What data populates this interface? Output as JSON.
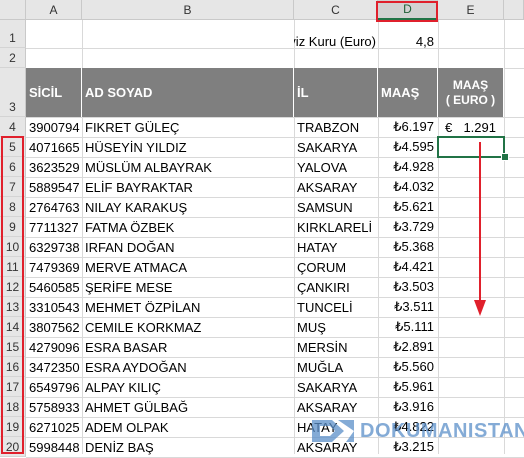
{
  "columns": [
    "A",
    "B",
    "C",
    "D",
    "E"
  ],
  "rate_label": "Döviz Kuru (Euro)",
  "rate_value": "4,8",
  "headers": {
    "sicil": "SİCİL",
    "ad_soyad": "AD SOYAD",
    "il": "İL",
    "maas": "MAAŞ",
    "maas_euro_1": "MAAŞ",
    "maas_euro_2": "( EURO )"
  },
  "euro_symbol": "€",
  "row4_euro": "1.291",
  "row_numbers": [
    "1",
    "2",
    "3",
    "4",
    "5",
    "6",
    "7",
    "8",
    "9",
    "10",
    "11",
    "12",
    "13",
    "14",
    "15",
    "16",
    "17",
    "18",
    "19",
    "20"
  ],
  "rows": [
    {
      "sicil": "3900794",
      "name": "FIKRET GÜLEÇ",
      "il": "TRABZON",
      "maas": "₺6.197"
    },
    {
      "sicil": "4071665",
      "name": "HÜSEYİN YILDIZ",
      "il": "SAKARYA",
      "maas": "₺4.595"
    },
    {
      "sicil": "3623529",
      "name": "MÜSLÜM ALBAYRAK",
      "il": "YALOVA",
      "maas": "₺4.928"
    },
    {
      "sicil": "5889547",
      "name": "ELİF BAYRAKTAR",
      "il": "AKSARAY",
      "maas": "₺4.032"
    },
    {
      "sicil": "2764763",
      "name": "NILAY KARAKUŞ",
      "il": "SAMSUN",
      "maas": "₺5.621"
    },
    {
      "sicil": "7711327",
      "name": "FATMA ÖZBEK",
      "il": "KIRKLARELİ",
      "maas": "₺3.729"
    },
    {
      "sicil": "6329738",
      "name": "IRFAN DOĞAN",
      "il": "HATAY",
      "maas": "₺5.368"
    },
    {
      "sicil": "7479369",
      "name": "MERVE ATMACA",
      "il": "ÇORUM",
      "maas": "₺4.421"
    },
    {
      "sicil": "5460585",
      "name": "ŞERİFE MESE",
      "il": "ÇANKIRI",
      "maas": "₺3.503"
    },
    {
      "sicil": "3310543",
      "name": "MEHMET ÖZPİLAN",
      "il": "TUNCELİ",
      "maas": "₺3.511"
    },
    {
      "sicil": "3807562",
      "name": "CEMILE KORKMAZ",
      "il": "MUŞ",
      "maas": "₺5.111"
    },
    {
      "sicil": "4279096",
      "name": "ESRA BASAR",
      "il": "MERSİN",
      "maas": "₺2.891"
    },
    {
      "sicil": "3472350",
      "name": "ESRA AYDOĞAN",
      "il": "MUĞLA",
      "maas": "₺5.560"
    },
    {
      "sicil": "6549796",
      "name": "ALPAY KILIÇ",
      "il": "SAKARYA",
      "maas": "₺5.961"
    },
    {
      "sicil": "5758933",
      "name": "AHMET GÜLBAĞ",
      "il": "AKSARAY",
      "maas": "₺3.916"
    },
    {
      "sicil": "6271025",
      "name": "ADEM OLPAK",
      "il": "HATAY",
      "maas": "₺4.822"
    },
    {
      "sicil": "5998448",
      "name": "DENİZ BAŞ",
      "il": "AKSARAY",
      "maas": "₺3.215"
    }
  ],
  "watermark": "DOKUMANISTAN",
  "colors": {
    "header_fill": "#7f7f7f",
    "annotation_red": "#e0202c",
    "excel_green": "#217346",
    "watermark_blue": "#5b8fc9"
  }
}
